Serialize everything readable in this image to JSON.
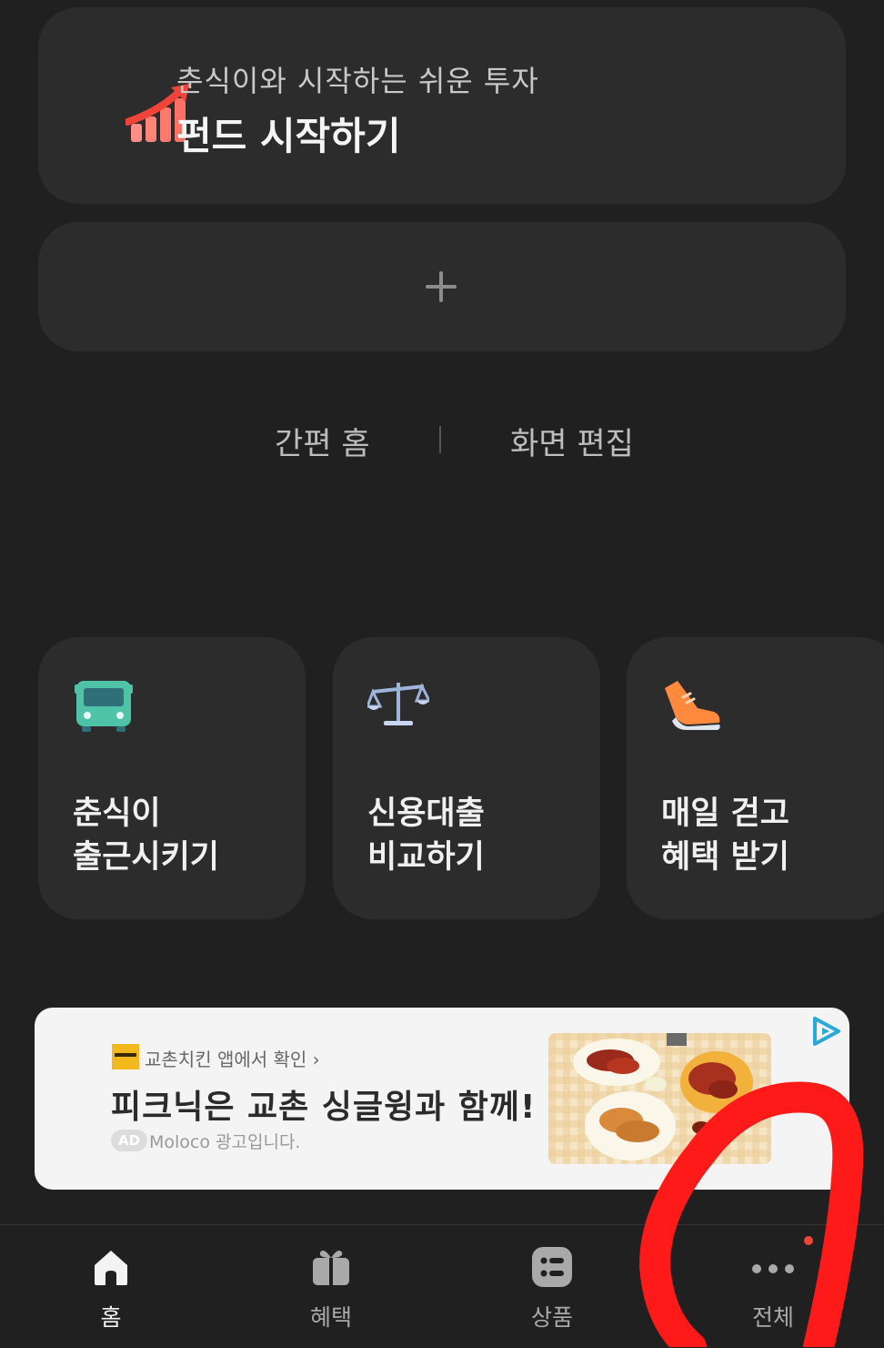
{
  "fund_card": {
    "subtitle": "춘식이와 시작하는 쉬운 투자",
    "title": "펀드 시작하기",
    "icon": "chart-up-icon"
  },
  "add_card": {
    "icon": "plus-icon"
  },
  "links": {
    "simple_home": "간편 홈",
    "edit_screen": "화면 편집"
  },
  "tiles": [
    {
      "line1": "춘식이",
      "line2": "출근시키기",
      "icon": "bus-icon"
    },
    {
      "line1": "신용대출",
      "line2": "비교하기",
      "icon": "scale-icon"
    },
    {
      "line1": "매일 걷고",
      "line2": "혜택 받기",
      "icon": "sneaker-icon"
    }
  ],
  "ad": {
    "brand_link": "교촌치킨 앱에서 확인 ›",
    "headline": "피크닉은 교촌 싱글윙과 함께!",
    "badge": "AD",
    "sponsor": "Moloco 광고입니다.",
    "icons": [
      "kyochon-logo-icon",
      "chicken-photo",
      "adchoices-icon"
    ]
  },
  "tabbar": {
    "items": [
      {
        "label": "홈",
        "icon": "home-icon",
        "active": true
      },
      {
        "label": "혜택",
        "icon": "gift-icon",
        "active": false
      },
      {
        "label": "상품",
        "icon": "products-icon",
        "active": false
      },
      {
        "label": "전체",
        "icon": "more-icon",
        "active": false,
        "notification": true
      }
    ]
  },
  "colors": {
    "background": "#202020",
    "card": "#2c2c2c",
    "accent_red": "#f04438",
    "annotation_red": "#ff1a1a"
  }
}
